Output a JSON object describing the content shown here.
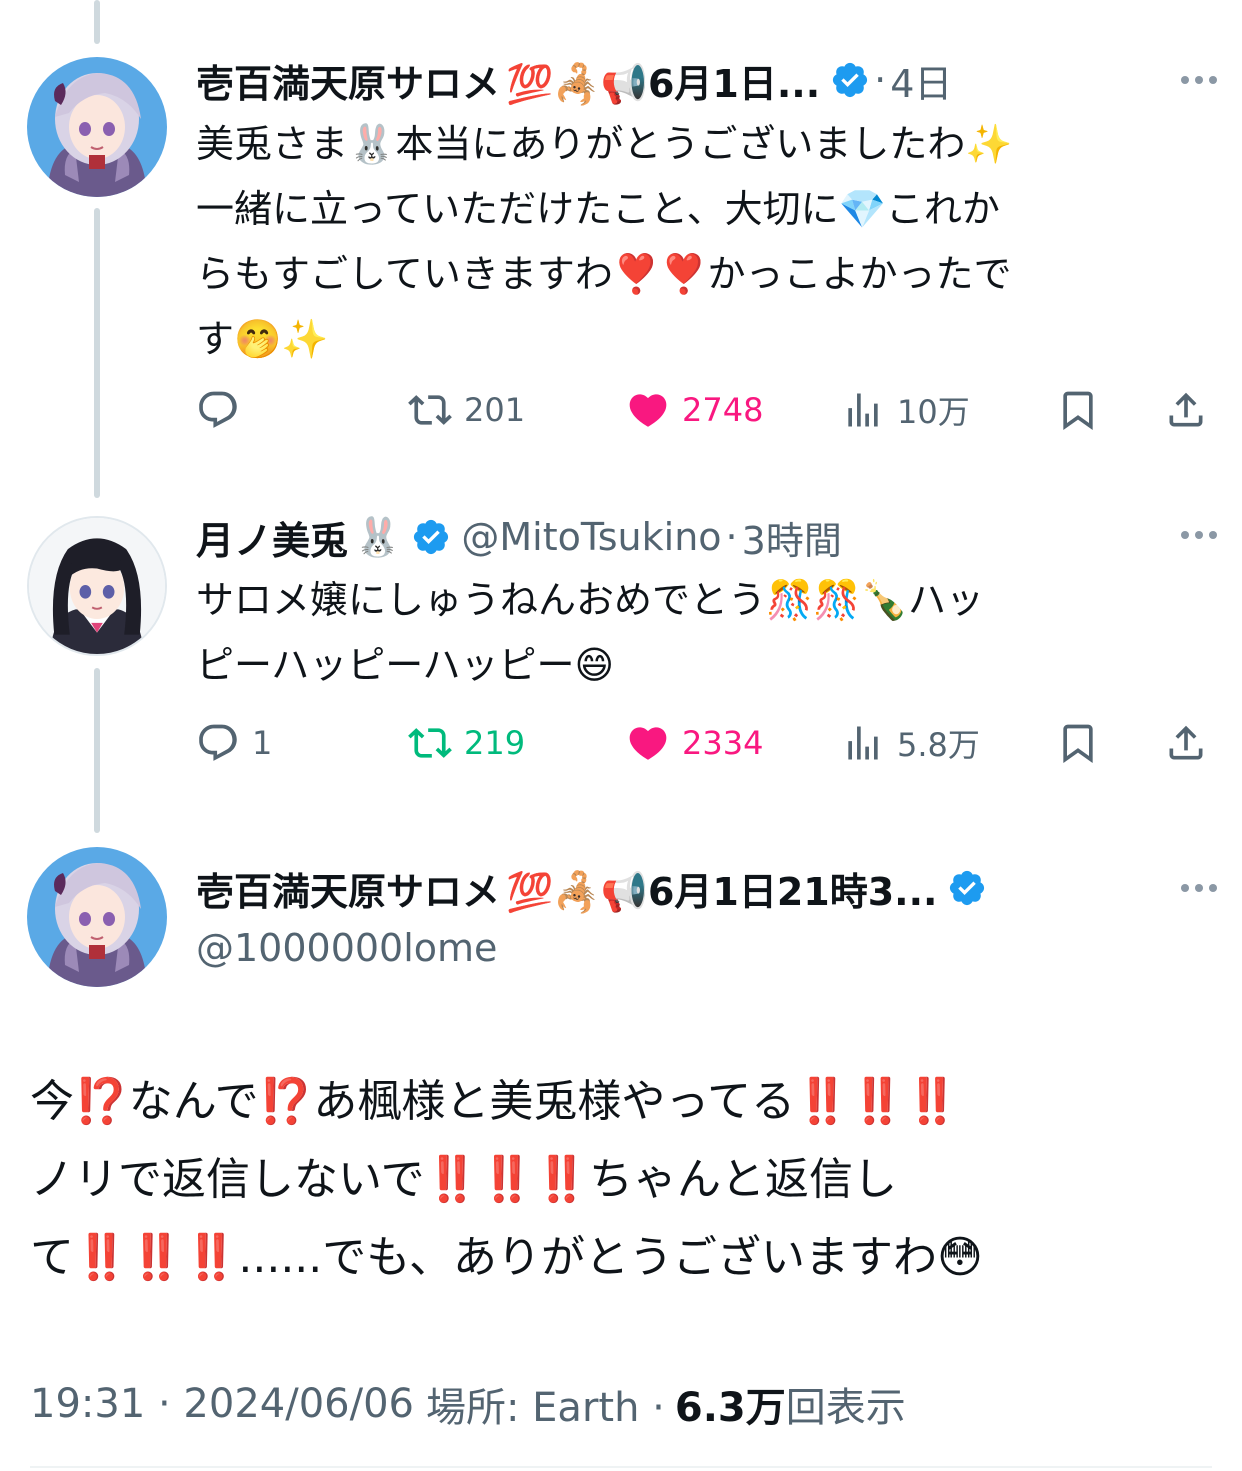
{
  "tweets": [
    {
      "display_name": "壱百満天原サロメ",
      "name_emojis": "💯🦂📢6月1日...",
      "time": "4日",
      "text_lines": [
        "美兎さま🐰本当にありがとうございましたわ✨",
        "一緒に立っていただけたこと、大切に💎これか",
        "らもすごしていきますわ❣️❣️かっこよかったで",
        "す🤭✨"
      ],
      "reply_count": "",
      "retweet_count": "201",
      "like_count": "2748",
      "view_count": "10万"
    },
    {
      "display_name": "月ノ美兎",
      "name_emojis": "🐰",
      "handle": "@MitoTsukino",
      "time": "3時間",
      "text_lines": [
        "サロメ嬢にしゅうねんおめでとう🎊🎊🍾ハッ",
        "ピーハッピーハッピー😄"
      ],
      "reply_count": "1",
      "retweet_count": "219",
      "like_count": "2334",
      "view_count": "5.8万"
    }
  ],
  "main_tweet": {
    "display_name": "壱百満天原サロメ",
    "name_emojis": "💯🦂📢6月1日21時3...",
    "handle": "@1000000lome",
    "text_lines": [
      "今⁉️なんで⁉️あ楓様と美兎様やってる‼️‼️‼️",
      "ノリで返信しないで‼️‼️‼️ちゃんと返信し",
      "て‼️‼️‼️......でも、ありがとうございますわ😳"
    ],
    "time_date": "19:31 · 2024/06/06",
    "location": "場所: Earth ·",
    "views": "6.3万",
    "views_label": "回表示"
  },
  "colors": {
    "verified": "#1d9bf0",
    "like": "#f91880",
    "retweet_active": "#00ba7c",
    "muted": "#536471"
  },
  "icons": [
    "reply-icon",
    "retweet-icon",
    "like-icon",
    "views-icon",
    "bookmark-icon",
    "share-icon",
    "verified-icon",
    "more-icon"
  ]
}
